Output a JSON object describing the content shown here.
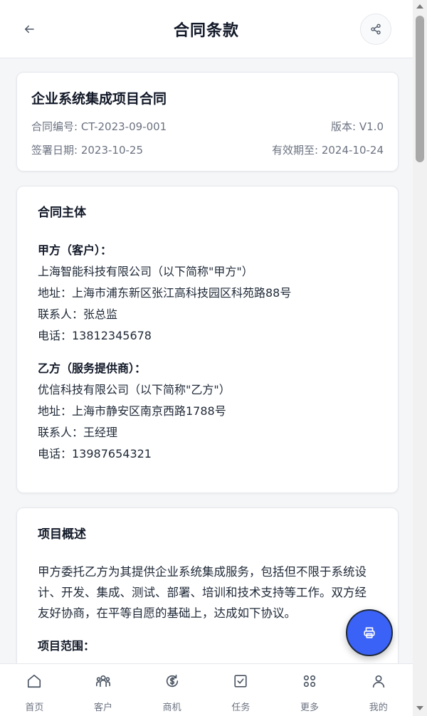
{
  "header": {
    "title": "合同条款",
    "back_icon": "arrow-left-icon",
    "share_icon": "share-icon"
  },
  "contract": {
    "title": "企业系统集成项目合同",
    "number": "合同编号: CT-2023-09-001",
    "version": "版本: V1.0",
    "sign_date": "签署日期: 2023-10-25",
    "valid_until": "有效期至: 2024-10-24"
  },
  "parties": {
    "section_title": "合同主体",
    "party_a": {
      "label": "甲方（客户）：",
      "name": "上海智能科技有限公司（以下简称\"甲方\"）",
      "address": "地址：上海市浦东新区张江高科技园区科苑路88号",
      "contact": "联系人：张总监",
      "phone": "电话：13812345678"
    },
    "party_b": {
      "label": "乙方（服务提供商）：",
      "name": "优信科技有限公司（以下简称\"乙方\"）",
      "address": "地址：上海市静安区南京西路1788号",
      "contact": "联系人：王经理",
      "phone": "电话：13987654321"
    }
  },
  "overview": {
    "section_title": "项目概述",
    "body": "甲方委托乙方为其提供企业系统集成服务，包括但不限于系统设计、开发、集成、测试、部署、培训和技术支持等工作。双方经友好协商，在平等自愿的基础上，达成如下协议。",
    "scope_title": "项目范围："
  },
  "fab": {
    "icon": "print-icon"
  },
  "nav": [
    {
      "label": "首页",
      "icon": "home-icon"
    },
    {
      "label": "客户",
      "icon": "users-icon"
    },
    {
      "label": "商机",
      "icon": "dollar-icon"
    },
    {
      "label": "任务",
      "icon": "checkbox-icon"
    },
    {
      "label": "更多",
      "icon": "grid-icon"
    },
    {
      "label": "我的",
      "icon": "user-icon"
    }
  ],
  "colors": {
    "accent": "#3b62f6",
    "text": "#111827",
    "muted": "#6b7280"
  }
}
